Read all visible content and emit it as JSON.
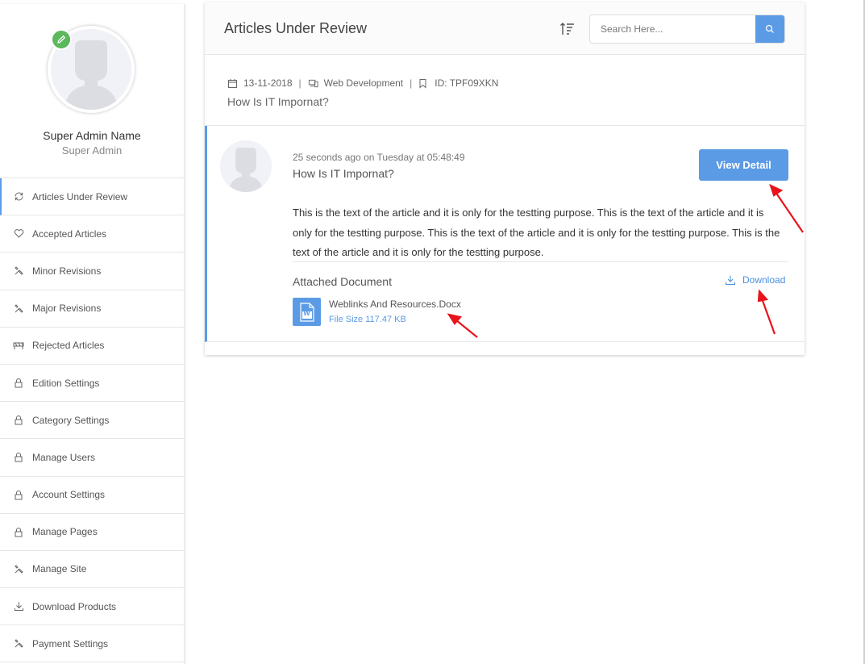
{
  "sidebar": {
    "profile": {
      "name": "Super Admin Name",
      "role": "Super Admin"
    },
    "items": [
      {
        "label": "Articles Under Review",
        "icon": "refresh-icon",
        "active": true
      },
      {
        "label": "Accepted Articles",
        "icon": "heart-icon"
      },
      {
        "label": "Minor Revisions",
        "icon": "tools-icon"
      },
      {
        "label": "Major Revisions",
        "icon": "tools-icon"
      },
      {
        "label": "Rejected Articles",
        "icon": "barrier-icon"
      },
      {
        "label": "Edition Settings",
        "icon": "lock-icon"
      },
      {
        "label": "Category Settings",
        "icon": "lock-icon"
      },
      {
        "label": "Manage Users",
        "icon": "lock-icon"
      },
      {
        "label": "Account Settings",
        "icon": "lock-icon"
      },
      {
        "label": "Manage Pages",
        "icon": "lock-icon"
      },
      {
        "label": "Manage Site",
        "icon": "tools-icon"
      },
      {
        "label": "Download Products",
        "icon": "download-icon"
      },
      {
        "label": "Payment Settings",
        "icon": "tools-icon"
      }
    ]
  },
  "header": {
    "title": "Articles Under Review",
    "search": {
      "placeholder": "Search Here...",
      "value": ""
    }
  },
  "article_meta": {
    "date": "13-11-2018",
    "category": "Web Development",
    "id_label": "ID: TPF09XKN",
    "title": "How Is IT Impornat?"
  },
  "review": {
    "time": "25 seconds ago on Tuesday at 05:48:49",
    "title": "How Is IT Impornat?",
    "view_button": "View Detail",
    "body": "This is the text of the article and it is only for the testting purpose. This is the text of the article and it is only for the testting purpose. This is the text of the article and it is only for the testting purpose. This is the text of the article and it is only for the testting purpose.",
    "attachment": {
      "label": "Attached Document",
      "download_label": "Download",
      "file_name": "Weblinks And Resources.Docx",
      "file_size": "File Size 117.47 KB",
      "file_icon_letter": "W"
    }
  },
  "colors": {
    "accent": "#5b9be6",
    "edit_badge": "#5cb85c",
    "annotation_arrow": "#e8141b"
  }
}
